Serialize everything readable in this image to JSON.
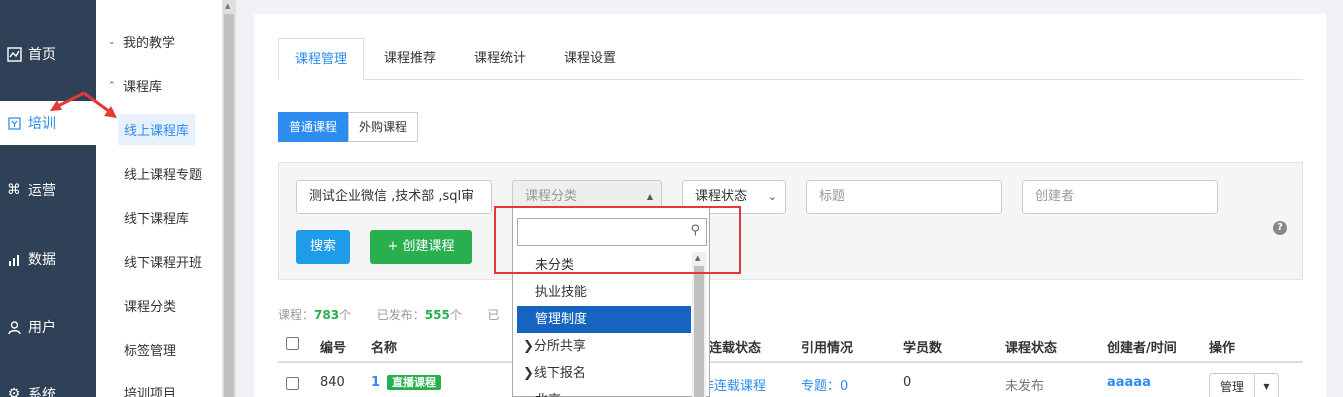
{
  "leftnav": [
    {
      "label": "首页",
      "icon": "chart-line-icon"
    },
    {
      "label": "培训",
      "icon": "book-icon",
      "active": true
    },
    {
      "label": "运营",
      "icon": "command-icon"
    },
    {
      "label": "数据",
      "icon": "bar-chart-icon"
    },
    {
      "label": "用户",
      "icon": "user-icon"
    },
    {
      "label": "系统",
      "icon": "gear-icon"
    }
  ],
  "subnav": {
    "my_teaching": "我的教学",
    "course_lib": "课程库",
    "items": [
      "线上课程库",
      "线上课程专题",
      "线下课程库",
      "线下课程开班",
      "课程分类",
      "标签管理",
      "培训项目"
    ]
  },
  "tabs": [
    "课程管理",
    "课程推荐",
    "课程统计",
    "课程设置"
  ],
  "segment": {
    "normal": "普通课程",
    "external": "外购课程"
  },
  "filters": {
    "dept_value": "测试企业微信 ,技术部 ,sql审",
    "category_placeholder": "课程分类",
    "status_label": "课程状态",
    "title_placeholder": "标题",
    "creator_placeholder": "创建者",
    "search_label": "搜索",
    "create_label": "+ 创建课程"
  },
  "stats": {
    "course_label": "课程：",
    "course_count": "783",
    "course_unit": "个",
    "published_label": "已发布：",
    "published_count": "555",
    "published_unit": "个",
    "cut": "已"
  },
  "table": {
    "headers": [
      "编号",
      "名称",
      "连载状态",
      "引用情况",
      "学员数",
      "课程状态",
      "创建者/时间",
      "操作"
    ],
    "row": {
      "id": "840",
      "name": "1",
      "badge": "直播课程",
      "serial": "非连载课程",
      "ref": "专题：0",
      "students": "0",
      "status": "未发布",
      "creator": "aaaaa",
      "action": "管理"
    }
  },
  "dropdown": {
    "options": [
      {
        "label": "未分类",
        "group": false
      },
      {
        "label": "执业技能",
        "group": false
      },
      {
        "label": "管理制度",
        "group": false,
        "selected": true
      },
      {
        "label": "分所共享",
        "group": true
      },
      {
        "label": "线下报名",
        "group": true
      },
      {
        "label": "北京",
        "group": false
      }
    ]
  },
  "colors": {
    "accent": "#2d8cf0",
    "nav_bg": "#2f4157",
    "green": "#28b04f",
    "annotation": "#e53935"
  }
}
